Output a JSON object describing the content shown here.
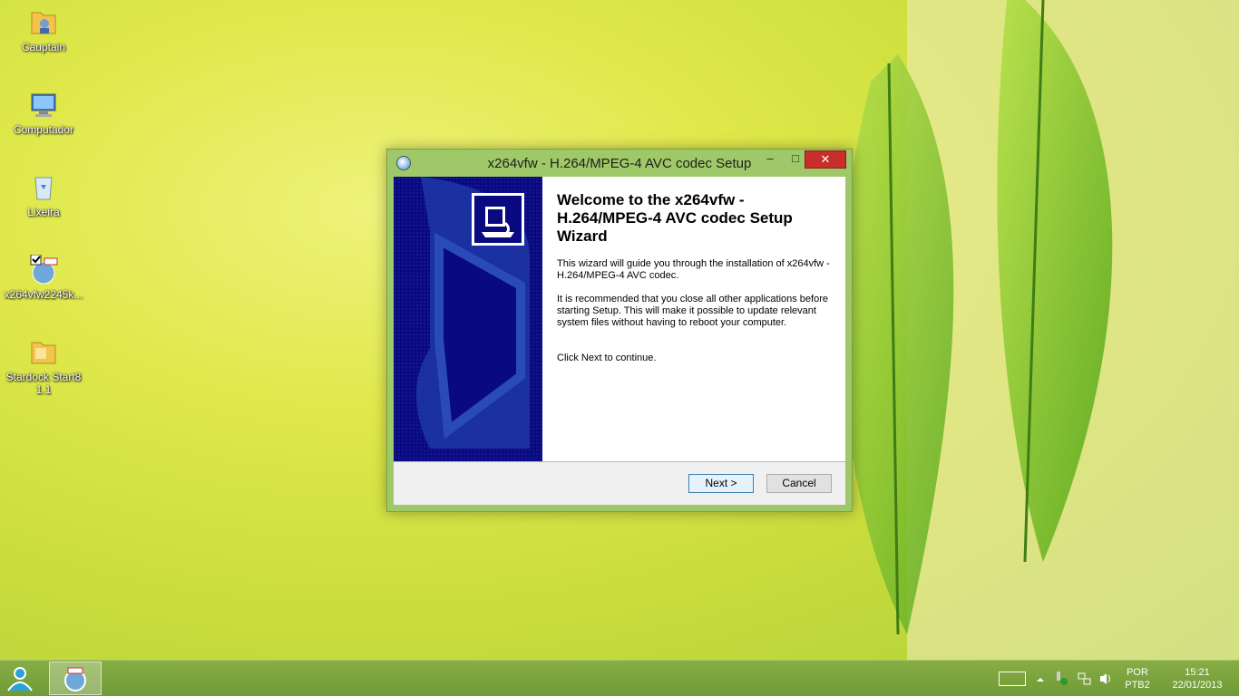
{
  "desktop": {
    "icons": [
      {
        "label": "Cauptain",
        "icon": "user-folder-icon"
      },
      {
        "label": "Computador",
        "icon": "computer-icon"
      },
      {
        "label": "Lixeira",
        "icon": "recycle-bin-icon"
      },
      {
        "label": "x264vfw2245k...",
        "icon": "installer-icon"
      },
      {
        "label": "Stardock Start8 1.1",
        "icon": "folder-icon"
      }
    ]
  },
  "window": {
    "title": "x264vfw - H.264/MPEG-4 AVC codec Setup",
    "controls": {
      "minimize": "–",
      "maximize": "□",
      "close": "✕"
    },
    "welcome_title": "Welcome to the x264vfw - H.264/MPEG-4 AVC codec Setup Wizard",
    "paragraphs": [
      "This wizard will guide you through the installation of x264vfw - H.264/MPEG-4 AVC codec.",
      "It is recommended that you close all other applications before starting Setup. This will make it possible to update relevant system files without having to reboot your computer.",
      "Click Next to continue."
    ],
    "buttons": {
      "next": "Next >",
      "cancel": "Cancel"
    }
  },
  "taskbar": {
    "language": {
      "line1": "POR",
      "line2": "PTB2"
    },
    "clock": {
      "time": "15:21",
      "date": "22/01/2013"
    }
  },
  "colors": {
    "accent_green": "#8fbf57",
    "banner_blue": "#0a0a80",
    "close_red": "#c7302a"
  }
}
